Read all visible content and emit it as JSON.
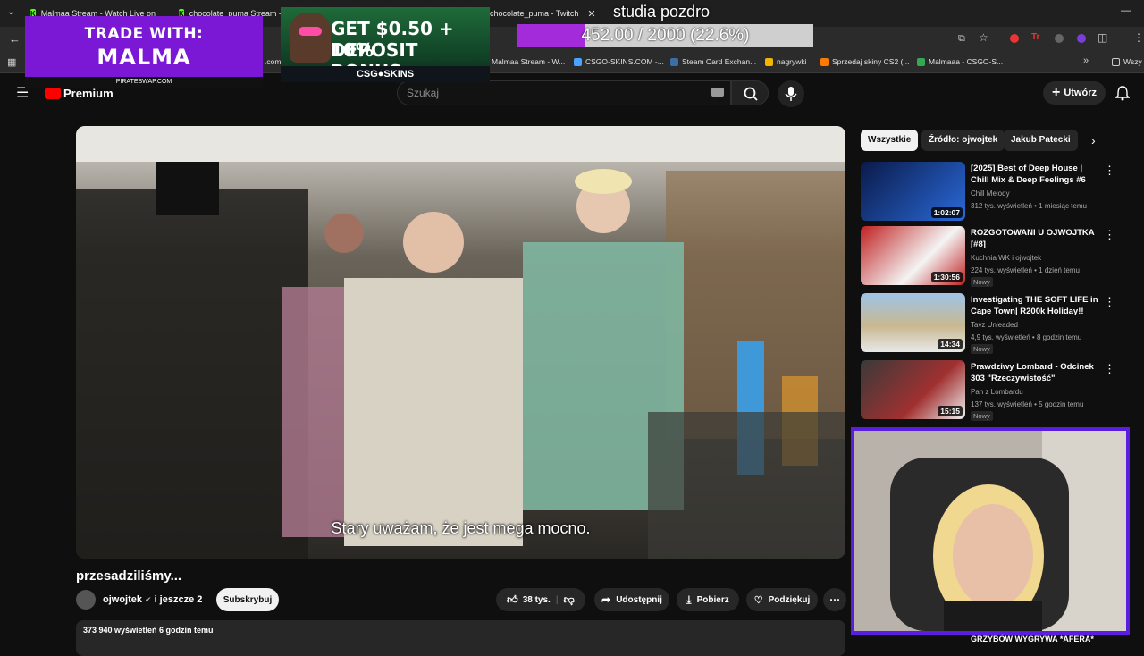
{
  "browser": {
    "tabs": [
      {
        "label": "Malmaa Stream - Watch Live on",
        "icon": "kick-icon"
      },
      {
        "label": "chocolate_puma Stream - W",
        "icon": "kick-icon"
      },
      {
        "label": "chocolate_puma - Twitch",
        "icon": "twitch-icon"
      }
    ],
    "bookmarks": [
      {
        "label": ".com",
        "color": "#888888"
      },
      {
        "label": "Malmaa Stream - W...",
        "color": "#53fc18"
      },
      {
        "label": "CSGO-SKINS.COM -...",
        "color": "#4aa3ff"
      },
      {
        "label": "Steam Card Exchan...",
        "color": "#3a6ea5"
      },
      {
        "label": "nagrywki",
        "color": "#f4b400"
      },
      {
        "label": "Sprzedaj skiny CS2 (...",
        "color": "#ff7a00"
      },
      {
        "label": "Malmaaa - CSGO-S...",
        "color": "#34a853"
      }
    ],
    "bookmarks_overflow": "Wszy"
  },
  "overlays": {
    "trade_line1": "TRADE WITH:",
    "trade_line2": "MALMA",
    "trade_url": "PIRATESWAP.COM",
    "csgo_line1": "GET $0.50 + 10%",
    "csgo_line2": "DEPOSIT BONUS",
    "csgo_brand": "CSG●SKINS",
    "progress_text": "452.00 / 2000 (22.6%)",
    "progress_fraction": 0.226,
    "stream_title": "studia pozdro"
  },
  "youtube": {
    "logo_text": "Premium",
    "search_placeholder": "Szukaj",
    "create_label": "Utwórz",
    "video_title": "przesadziliśmy...",
    "subtitle": "Stary uważam, że jest mega mocno.",
    "channel_name": "ojwojtek",
    "channel_extra": "i jeszcze 2",
    "subscribe_label": "Subskrybuj",
    "likes": "38 tys.",
    "share_label": "Udostępnij",
    "download_label": "Pobierz",
    "thanks_label": "Podziękuj",
    "views_line": "373 940 wyświetleń  6 godzin temu"
  },
  "sidebar": {
    "chips": [
      "Wszystkie",
      "Źródło: ojwojtek",
      "Jakub Patecki"
    ],
    "videos": [
      {
        "title": "[2025] Best of Deep House | Chill Mix & Deep Feelings #6",
        "channel": "Chill Melody",
        "meta": "312 tys. wyświetleń • 1 miesiąc temu",
        "duration": "1:02:07",
        "badge": ""
      },
      {
        "title": "ROZGOTOWANI U OJWOJTKA [#8]",
        "channel": "Kuchnia WK i ojwojtek",
        "meta": "224 tys. wyświetleń • 1 dzień temu",
        "duration": "1:30:56",
        "badge": "Nowy"
      },
      {
        "title": "Investigating THE SOFT LIFE in Cape Town| R200k Holiday!!",
        "channel": "Tavz Unleaded",
        "meta": "4,9 tys. wyświetleń • 8 godzin temu",
        "duration": "14:34",
        "badge": "Nowy"
      },
      {
        "title": "Prawdziwy Lombard - Odcinek 303 \"Rzeczywistość\"",
        "channel": "Pan z Lombardu",
        "meta": "137 tys. wyświetleń • 5 godzin temu",
        "duration": "15:15",
        "badge": "Nowy"
      }
    ]
  },
  "footer_text": "GRZYBÓW WYGRYWA *AFERA*"
}
